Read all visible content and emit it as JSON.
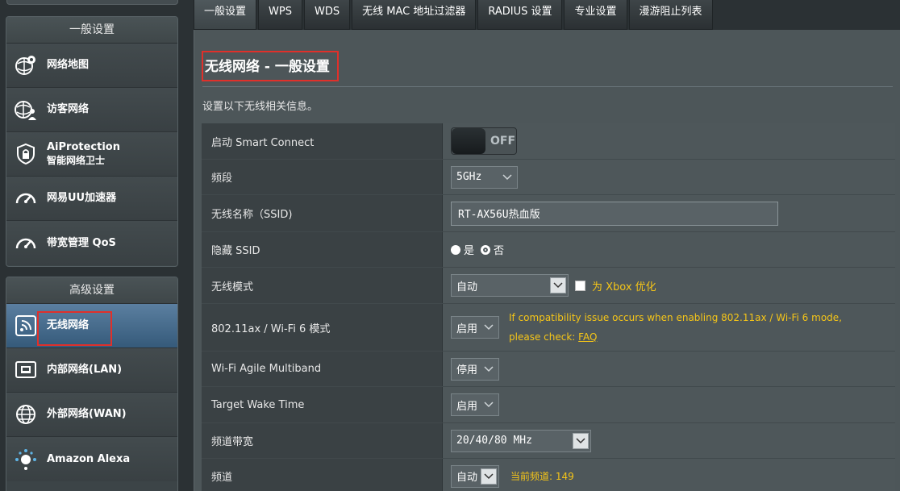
{
  "sidebar": {
    "group1_title": "一般设置",
    "group1_items": [
      {
        "label": "网络地图",
        "icon": "network-map-icon"
      },
      {
        "label": "访客网络",
        "icon": "guest-network-icon"
      },
      {
        "label": "AiProtection",
        "sub": "智能网络卫士",
        "icon": "shield-lock-icon"
      },
      {
        "label": "网易UU加速器",
        "icon": "gauge-icon"
      },
      {
        "label": "带宽管理 QoS",
        "icon": "gauge-icon"
      }
    ],
    "group2_title": "高级设置",
    "group2_items": [
      {
        "label": "无线网络",
        "icon": "wireless-icon"
      },
      {
        "label": "内部网络(LAN)",
        "icon": "lan-icon"
      },
      {
        "label": "外部网络(WAN)",
        "icon": "globe-icon"
      },
      {
        "label": "Amazon Alexa",
        "icon": "alexa-icon"
      }
    ]
  },
  "tabs": [
    {
      "label": "一般设置",
      "active": true
    },
    {
      "label": "WPS"
    },
    {
      "label": "WDS"
    },
    {
      "label": "无线 MAC 地址过滤器"
    },
    {
      "label": "RADIUS 设置"
    },
    {
      "label": "专业设置"
    },
    {
      "label": "漫游阻止列表"
    }
  ],
  "page": {
    "title": "无线网络 - 一般设置",
    "description": "设置以下无线相关信息。"
  },
  "form": {
    "smart_connect": {
      "label": "启动 Smart Connect",
      "state": "OFF"
    },
    "band": {
      "label": "频段",
      "value": "5GHz"
    },
    "ssid": {
      "label": "无线名称（SSID)",
      "value": "RT-AX56U热血版"
    },
    "hide_ssid": {
      "label": "隐藏 SSID",
      "opt_yes": "是",
      "opt_no": "否"
    },
    "wireless_mode": {
      "label": "无线模式",
      "value": "自动",
      "xbox_label": "为 Xbox 优化"
    },
    "ax_mode": {
      "label": "802.11ax / Wi-Fi 6 模式",
      "value": "启用",
      "hint_line1": "If compatibility issue occurs when enabling 802.11ax / Wi-Fi 6 mode,",
      "hint_line2": "please check: ",
      "hint_link": "FAQ"
    },
    "agile_multiband": {
      "label": "Wi-Fi Agile Multiband",
      "value": "停用"
    },
    "twt": {
      "label": "Target Wake Time",
      "value": "启用"
    },
    "bandwidth": {
      "label": "频道带宽",
      "value": "20/40/80 MHz"
    },
    "channel": {
      "label": "频道",
      "value": "自动",
      "current_label": "当前频道: 149"
    }
  },
  "colors": {
    "highlight": "#e0302a",
    "hint": "#f5c518",
    "active_item": "#3f6686"
  }
}
